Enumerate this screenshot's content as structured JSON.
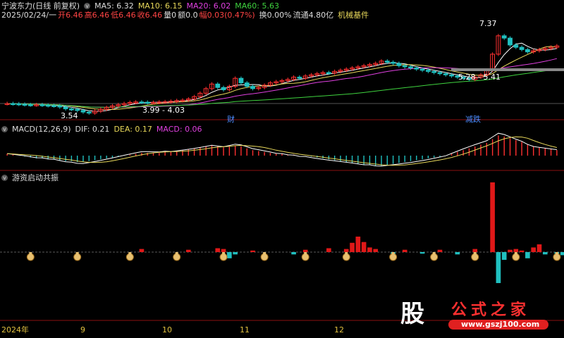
{
  "header": {
    "stock_title": "宁波东力(日线 前复权)",
    "ma5": "MA5: 6.32",
    "ma10": "MA10: 6.15",
    "ma20": "MA20: 6.02",
    "ma60": "MA60: 5.63",
    "date": "2025/02/24/一",
    "open": "开6.46",
    "high": "高6.46",
    "low": "低6.46",
    "close": "收6.46",
    "volume": "量0",
    "amount": "额0.0",
    "change": "幅0.03(0.47%)",
    "turnover": "换0.00%",
    "float_cap": "流通4.80亿",
    "sector": "机械基件"
  },
  "macd_header": {
    "name": "MACD(12,26,9)",
    "dif": "DIF: 0.21",
    "dea": "DEA: 0.17",
    "macd": "MACD: 0.06"
  },
  "indicator_header": {
    "name": "游资启动共振"
  },
  "annotations": {
    "price_high": "7.37",
    "price_low_1": "3.54",
    "range_1": "3.99 - 4.03",
    "range_2": "5.28 - 5.41",
    "event_1": "财",
    "event_2": "减跌"
  },
  "x_axis": [
    "2024年",
    "9",
    "10",
    "11",
    "12"
  ],
  "watermark": {
    "glyph": "股",
    "site_name": "公式之家",
    "url": "www.gszj100.com"
  },
  "colors": {
    "up": "#ff3030",
    "down": "#20c0c0",
    "ma5": "#ffffff",
    "ma10": "#e8d85a",
    "ma20": "#e040e0",
    "ma60": "#3fd33f"
  },
  "chart_data": [
    {
      "type": "candlestick",
      "title": "宁波东力(日线 前复权)",
      "close": [
        3.95,
        3.94,
        3.92,
        3.9,
        3.89,
        3.9,
        3.88,
        3.86,
        3.85,
        3.8,
        3.72,
        3.7,
        3.65,
        3.58,
        3.54,
        3.62,
        3.7,
        3.78,
        3.85,
        3.9,
        3.95,
        4.0,
        4.02,
        4.01,
        3.99,
        4.0,
        4.02,
        4.03,
        4.05,
        4.08,
        4.1,
        4.15,
        4.25,
        4.4,
        4.6,
        4.8,
        4.65,
        4.55,
        4.7,
        5.05,
        4.85,
        4.7,
        4.6,
        4.65,
        4.75,
        4.85,
        4.9,
        4.95,
        5.0,
        5.1,
        5.05,
        5.15,
        5.2,
        5.25,
        5.3,
        5.28,
        5.35,
        5.4,
        5.45,
        5.5,
        5.55,
        5.6,
        5.65,
        5.7,
        5.8,
        5.75,
        5.7,
        5.6,
        5.55,
        5.5,
        5.45,
        5.4,
        5.35,
        5.3,
        5.25,
        5.2,
        5.15,
        5.1,
        5.05,
        5.0,
        5.1,
        5.2,
        5.4,
        6.1,
        6.9,
        6.8,
        6.5,
        6.4,
        6.3,
        6.2,
        6.25,
        6.3,
        6.35,
        6.4,
        6.46
      ],
      "ma": [
        "MA5",
        "MA10",
        "MA20",
        "MA60"
      ],
      "ylim": [
        3.4,
        7.6
      ]
    },
    {
      "type": "macd",
      "series": [
        {
          "name": "DIF"
        },
        {
          "name": "DEA"
        },
        {
          "name": "MACD"
        }
      ],
      "values": [
        0.02,
        0.01,
        0.0,
        -0.01,
        -0.02,
        -0.03,
        -0.03,
        -0.04,
        -0.04,
        -0.05,
        -0.06,
        -0.06,
        -0.07,
        -0.07,
        -0.06,
        -0.05,
        -0.04,
        -0.03,
        -0.02,
        -0.01,
        0.0,
        0.01,
        0.02,
        0.03,
        0.03,
        0.03,
        0.03,
        0.04,
        0.04,
        0.05,
        0.06,
        0.07,
        0.08,
        0.09,
        0.1,
        0.11,
        0.1,
        0.09,
        0.1,
        0.11,
        0.1,
        0.08,
        0.06,
        0.05,
        0.04,
        0.03,
        0.02,
        0.02,
        0.01,
        0.01,
        0.0,
        0.0,
        -0.01,
        -0.02,
        -0.03,
        -0.04,
        -0.05,
        -0.06,
        -0.07,
        -0.08,
        -0.09,
        -0.1,
        -0.1,
        -0.11,
        -0.11,
        -0.1,
        -0.09,
        -0.08,
        -0.07,
        -0.06,
        -0.05,
        -0.04,
        -0.03,
        -0.02,
        -0.01,
        0.0,
        0.02,
        0.04,
        0.06,
        0.08,
        0.1,
        0.12,
        0.14,
        0.18,
        0.22,
        0.21,
        0.19,
        0.17,
        0.15,
        0.12,
        0.1,
        0.09,
        0.08,
        0.07,
        0.06
      ]
    },
    {
      "type": "bar",
      "title": "游资启动共振",
      "values": [
        0,
        0,
        0,
        0,
        0,
        0,
        0,
        0,
        0,
        0,
        0,
        0,
        0,
        0,
        0,
        0,
        0,
        0,
        0,
        0,
        0,
        0,
        0,
        0.4,
        0,
        0,
        0,
        0,
        0,
        0,
        0,
        0.3,
        0,
        0,
        0,
        0,
        0.5,
        0.4,
        -0.8,
        -0.3,
        0,
        0,
        0.2,
        0,
        0,
        0,
        0,
        0,
        0,
        -0.3,
        0,
        0.3,
        0,
        0,
        0,
        0.5,
        0,
        0,
        0.4,
        1.2,
        2.0,
        1.3,
        0.6,
        0.4,
        0,
        0,
        -0.3,
        0,
        0.3,
        0,
        0,
        -0.2,
        0,
        0,
        0.3,
        0,
        0,
        -0.3,
        0,
        0,
        0.4,
        0,
        0,
        9.0,
        -4.0,
        -1.0,
        0.3,
        0.4,
        0.2,
        -0.8,
        0.6,
        1.0,
        -0.3,
        0,
        -0.5,
        -0.4,
        1.5,
        0.5,
        0.4
      ],
      "money_bag_markers": [
        4,
        12,
        21,
        29,
        37,
        44,
        51,
        58,
        66,
        73,
        80,
        87,
        94
      ]
    }
  ]
}
